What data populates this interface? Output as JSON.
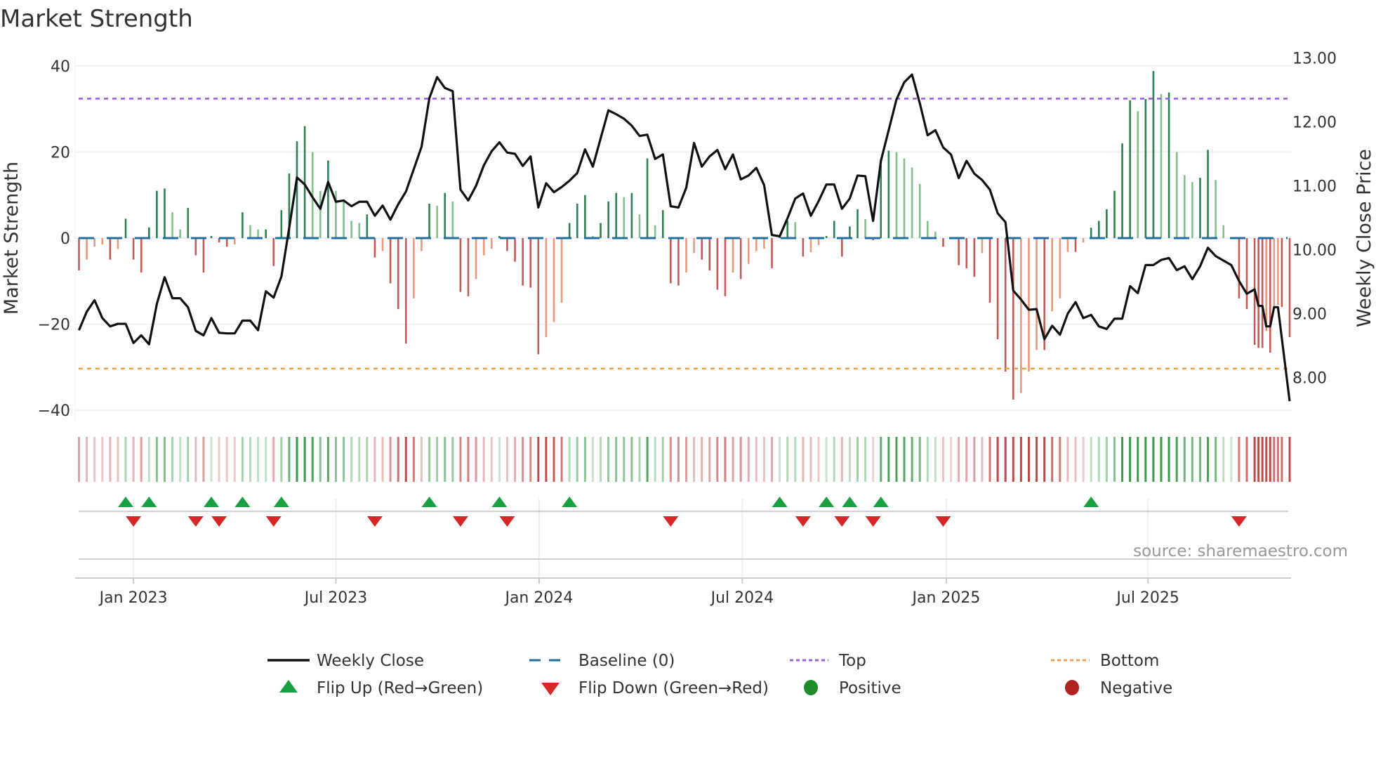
{
  "chart_data": {
    "type": "bar+line",
    "title": "Market Strength",
    "ylabel": "Market Strength",
    "y2label": "Weekly Close Price",
    "ylim": [
      -42,
      42
    ],
    "y2lim": [
      7.5,
      13.0
    ],
    "yticks": [
      40,
      20,
      0,
      -20,
      -40
    ],
    "yticks_labels": [
      "40",
      "20",
      "0",
      "−20",
      "−40"
    ],
    "y2ticks": [
      13,
      12,
      11,
      10,
      9,
      8
    ],
    "y2ticks_labels": [
      "13.00",
      "12.00",
      "11.00",
      "10.00",
      "9.00",
      "8.00"
    ],
    "x_unit": "weeks since 2022-11-14",
    "xticks": [
      {
        "week": 7,
        "label": "Jan 2023"
      },
      {
        "week": 33,
        "label": "Jul 2023"
      },
      {
        "week": 59.1,
        "label": "Jan 2024"
      },
      {
        "week": 85.2,
        "label": "Jul 2024"
      },
      {
        "week": 111.4,
        "label": "Jan 2025"
      },
      {
        "week": 137.3,
        "label": "Jul 2025"
      }
    ],
    "top_level": 32.4,
    "bottom_level": -30.3,
    "baseline": 0,
    "strength": [
      -7.5,
      -5,
      -2,
      -1.5,
      -5,
      -2.5,
      4.5,
      -5,
      -8,
      2.5,
      11,
      11.5,
      6,
      2,
      7,
      -4,
      -8,
      0.5,
      -1,
      -2,
      -1.5,
      6,
      3,
      2,
      2,
      -6.5,
      6.5,
      15,
      22.5,
      26,
      20,
      11,
      18,
      11,
      9,
      4,
      3.5,
      5.5,
      -4.5,
      -3,
      -10.5,
      -16.5,
      -24.5,
      -14,
      -3,
      8,
      7.5,
      10.5,
      8.5,
      -12.5,
      -13.5,
      -9.5,
      -4,
      -2.5,
      0.5,
      -3,
      -5.5,
      -11,
      -11.5,
      -27,
      -23,
      -19.5,
      -15,
      3.5,
      8,
      10,
      0.5,
      3.5,
      8.5,
      10.5,
      9.5,
      10.5,
      5.5,
      18.5,
      3,
      6.5,
      -10.5,
      -11,
      -8,
      -3.5,
      -5,
      -7.5,
      -12,
      -13.5,
      -8,
      -9.5,
      -6,
      -3,
      -2.5,
      -7,
      0.5,
      4,
      3.7,
      -4.3,
      -3.3,
      -1.6,
      0.5,
      4,
      -4.3,
      2.7,
      6.7,
      4.4,
      -0.5,
      17,
      20.3,
      20,
      18.5,
      16.4,
      12.6,
      4,
      1.5,
      -2,
      -0.3,
      -6.3,
      -7,
      -9,
      -3.5,
      -15,
      -23.5,
      -31,
      -37.5,
      -36,
      -31,
      -26,
      -26,
      -17,
      -14,
      -3.2,
      -3.2,
      -1,
      2.4,
      4,
      6.7,
      11,
      22,
      32,
      29.5,
      32.3,
      38.8,
      33.5,
      33.8,
      20,
      14.6,
      13,
      14,
      20.5,
      13.5,
      3,
      0.2,
      -14,
      -16.5,
      -24.8
    ],
    "strength_tail": [
      {
        "week": 151.5,
        "value": -25.5
      },
      {
        "week": 152,
        "value": -25.5
      },
      {
        "week": 152.5,
        "value": -21.6
      },
      {
        "week": 153,
        "value": -26.6
      },
      {
        "week": 153.5,
        "value": -16
      },
      {
        "week": 154,
        "value": -15.5
      },
      {
        "week": 154.5,
        "value": -16
      },
      {
        "week": 155.5,
        "value": -23
      }
    ],
    "close": [
      8.74,
      9.03,
      9.21,
      8.93,
      8.8,
      8.84,
      8.84,
      8.54,
      8.66,
      8.52,
      9.15,
      9.57,
      9.24,
      9.24,
      9.1,
      8.73,
      8.66,
      8.93,
      8.7,
      8.69,
      8.69,
      8.89,
      8.89,
      8.74,
      9.35,
      9.25,
      9.58,
      10.34,
      11.13,
      11.02,
      10.82,
      10.64,
      11.06,
      10.75,
      10.77,
      10.68,
      10.75,
      10.75,
      10.53,
      10.69,
      10.47,
      10.71,
      10.91,
      11.26,
      11.61,
      12.37,
      12.7,
      12.53,
      12.48,
      10.94,
      10.77,
      11.0,
      11.32,
      11.54,
      11.68,
      11.52,
      11.5,
      11.31,
      11.46,
      10.66,
      11.04,
      10.9,
      10.98,
      11.08,
      11.2,
      11.57,
      11.3,
      11.74,
      12.18,
      12.12,
      12.05,
      11.94,
      11.78,
      11.8,
      11.42,
      11.49,
      10.68,
      10.66,
      10.97,
      11.67,
      11.3,
      11.46,
      11.56,
      11.26,
      11.49,
      11.1,
      11.16,
      11.28,
      11.01,
      10.23,
      10.21,
      10.49,
      10.8,
      10.88,
      10.53,
      10.76,
      11.02,
      11.02,
      10.64,
      10.8,
      11.16,
      11.15,
      10.45,
      11.39,
      11.87,
      12.35,
      12.62,
      12.74,
      12.29,
      11.79,
      11.87,
      11.6,
      11.49,
      11.12,
      11.39,
      11.19,
      11.09,
      10.94,
      10.57,
      10.43,
      9.36,
      9.22,
      9.06,
      9.07,
      8.6,
      8.81,
      8.67,
      9.0,
      9.18,
      8.93,
      8.98,
      8.8,
      8.76,
      8.92,
      8.92,
      9.43,
      9.32,
      9.76,
      9.76,
      9.84,
      9.87,
      9.68,
      9.74,
      9.54,
      9.74,
      10.03,
      9.9,
      9.83,
      9.76,
      9.51,
      9.31,
      9.38
    ],
    "close_tail": [
      {
        "week": 151.5,
        "value": 9.12
      },
      {
        "week": 152,
        "value": 9.12
      },
      {
        "week": 152.5,
        "value": 8.8
      },
      {
        "week": 153,
        "value": 8.8
      },
      {
        "week": 153.5,
        "value": 9.1
      },
      {
        "week": 154,
        "value": 9.1
      },
      {
        "week": 155.5,
        "value": 7.63
      }
    ],
    "flip_up_weeks": [
      6,
      9,
      17,
      21,
      26,
      45,
      54,
      63,
      90,
      96,
      99,
      103,
      130
    ],
    "flip_down_weeks": [
      7,
      15,
      18,
      25,
      38,
      49,
      55,
      76,
      93,
      98,
      102,
      111,
      149
    ],
    "legend": {
      "placement": "bottom",
      "items": [
        {
          "label": "Weekly Close",
          "kind": "line"
        },
        {
          "label": "Baseline (0)",
          "kind": "dash"
        },
        {
          "label": "Top",
          "kind": "dot"
        },
        {
          "label": "Bottom",
          "kind": "dot-orange"
        },
        {
          "label": "Flip Up (Red→Green)",
          "kind": "up"
        },
        {
          "label": "Flip Down (Green→Red)",
          "kind": "down"
        },
        {
          "label": "Positive",
          "kind": "pos"
        },
        {
          "label": "Negative",
          "kind": "neg"
        }
      ]
    },
    "source": "source: sharemaestro.com"
  },
  "colors": {
    "pos_strong": "#2e8050",
    "pos_weak": "#84c08c",
    "neg_strong": "#c25a5a",
    "neg_weak": "#e89a7c",
    "baseline": "#1f6fa0",
    "top": "#9b5fe0",
    "bottom": "#f0a050",
    "flip_up": "#1aa040",
    "flip_down": "#d62728",
    "positive": "#1e8c2a",
    "negative": "#b22222",
    "close": "#111111"
  }
}
